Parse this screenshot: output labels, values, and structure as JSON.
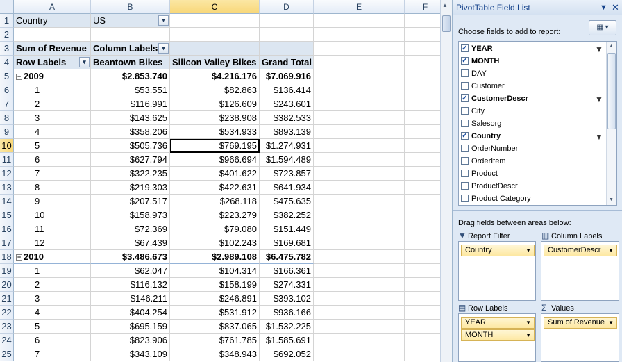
{
  "columns": [
    "A",
    "B",
    "C",
    "D",
    "E",
    "F"
  ],
  "rows": [
    {
      "n": "1",
      "a": "Country",
      "b": "US",
      "c": "",
      "d": "",
      "kind": "filter"
    },
    {
      "n": "2",
      "a": "",
      "b": "",
      "c": "",
      "d": "",
      "kind": "blank"
    },
    {
      "n": "3",
      "a": "Sum of Revenue",
      "b": "Column Labels",
      "c": "",
      "d": "",
      "kind": "header1"
    },
    {
      "n": "4",
      "a": "Row Labels",
      "b": "Beantown Bikes",
      "c": "Silicon Valley Bikes",
      "d": "Grand Total",
      "kind": "header2"
    },
    {
      "n": "5",
      "a": "2009",
      "b": "$2.853.740",
      "c": "$4.216.176",
      "d": "$7.069.916",
      "kind": "year"
    },
    {
      "n": "6",
      "a": "1",
      "b": "$53.551",
      "c": "$82.863",
      "d": "$136.414",
      "kind": "month"
    },
    {
      "n": "7",
      "a": "2",
      "b": "$116.991",
      "c": "$126.609",
      "d": "$243.601",
      "kind": "month"
    },
    {
      "n": "8",
      "a": "3",
      "b": "$143.625",
      "c": "$238.908",
      "d": "$382.533",
      "kind": "month"
    },
    {
      "n": "9",
      "a": "4",
      "b": "$358.206",
      "c": "$534.933",
      "d": "$893.139",
      "kind": "month"
    },
    {
      "n": "10",
      "a": "5",
      "b": "$505.736",
      "c": "$769.195",
      "d": "$1.274.931",
      "kind": "month"
    },
    {
      "n": "11",
      "a": "6",
      "b": "$627.794",
      "c": "$966.694",
      "d": "$1.594.489",
      "kind": "month"
    },
    {
      "n": "12",
      "a": "7",
      "b": "$322.235",
      "c": "$401.622",
      "d": "$723.857",
      "kind": "month"
    },
    {
      "n": "13",
      "a": "8",
      "b": "$219.303",
      "c": "$422.631",
      "d": "$641.934",
      "kind": "month"
    },
    {
      "n": "14",
      "a": "9",
      "b": "$207.517",
      "c": "$268.118",
      "d": "$475.635",
      "kind": "month"
    },
    {
      "n": "15",
      "a": "10",
      "b": "$158.973",
      "c": "$223.279",
      "d": "$382.252",
      "kind": "month"
    },
    {
      "n": "16",
      "a": "11",
      "b": "$72.369",
      "c": "$79.080",
      "d": "$151.449",
      "kind": "month"
    },
    {
      "n": "17",
      "a": "12",
      "b": "$67.439",
      "c": "$102.243",
      "d": "$169.681",
      "kind": "month"
    },
    {
      "n": "18",
      "a": "2010",
      "b": "$3.486.673",
      "c": "$2.989.108",
      "d": "$6.475.782",
      "kind": "year"
    },
    {
      "n": "19",
      "a": "1",
      "b": "$62.047",
      "c": "$104.314",
      "d": "$166.361",
      "kind": "month"
    },
    {
      "n": "20",
      "a": "2",
      "b": "$116.132",
      "c": "$158.199",
      "d": "$274.331",
      "kind": "month"
    },
    {
      "n": "21",
      "a": "3",
      "b": "$146.211",
      "c": "$246.891",
      "d": "$393.102",
      "kind": "month"
    },
    {
      "n": "22",
      "a": "4",
      "b": "$404.254",
      "c": "$531.912",
      "d": "$936.166",
      "kind": "month"
    },
    {
      "n": "23",
      "a": "5",
      "b": "$695.159",
      "c": "$837.065",
      "d": "$1.532.225",
      "kind": "month"
    },
    {
      "n": "24",
      "a": "6",
      "b": "$823.906",
      "c": "$761.785",
      "d": "$1.585.691",
      "kind": "month"
    },
    {
      "n": "25",
      "a": "7",
      "b": "$343.109",
      "c": "$348.943",
      "d": "$692.052",
      "kind": "month"
    }
  ],
  "active_cell": {
    "col": "C",
    "row": "10"
  },
  "panel": {
    "title": "PivotTable Field List",
    "choose_label": "Choose fields to add to report:",
    "fields": [
      {
        "label": "YEAR",
        "checked": true,
        "filtered": true
      },
      {
        "label": "MONTH",
        "checked": true,
        "filtered": false
      },
      {
        "label": "DAY",
        "checked": false,
        "filtered": false
      },
      {
        "label": "Customer",
        "checked": false,
        "filtered": false
      },
      {
        "label": "CustomerDescr",
        "checked": true,
        "filtered": true
      },
      {
        "label": "City",
        "checked": false,
        "filtered": false
      },
      {
        "label": "Salesorg",
        "checked": false,
        "filtered": false
      },
      {
        "label": "Country",
        "checked": true,
        "filtered": true
      },
      {
        "label": "OrderNumber",
        "checked": false,
        "filtered": false
      },
      {
        "label": "OrderItem",
        "checked": false,
        "filtered": false
      },
      {
        "label": "Product",
        "checked": false,
        "filtered": false
      },
      {
        "label": "ProductDescr",
        "checked": false,
        "filtered": false
      },
      {
        "label": "Product Category",
        "checked": false,
        "filtered": false
      }
    ],
    "drag_label": "Drag fields between areas below:",
    "areas": {
      "report_filter": {
        "label": "Report Filter",
        "items": [
          "Country"
        ]
      },
      "column_labels": {
        "label": "Column Labels",
        "items": [
          "CustomerDescr"
        ]
      },
      "row_labels": {
        "label": "Row Labels",
        "items": [
          "YEAR",
          "MONTH"
        ]
      },
      "values": {
        "label": "Values",
        "items": [
          "Sum of Revenue"
        ]
      }
    }
  },
  "colors": {
    "pivot_header": "#dce6f1",
    "selection": "#f8d778",
    "panel_bg": "#dfe9f5",
    "pill": "#fde8a1"
  }
}
